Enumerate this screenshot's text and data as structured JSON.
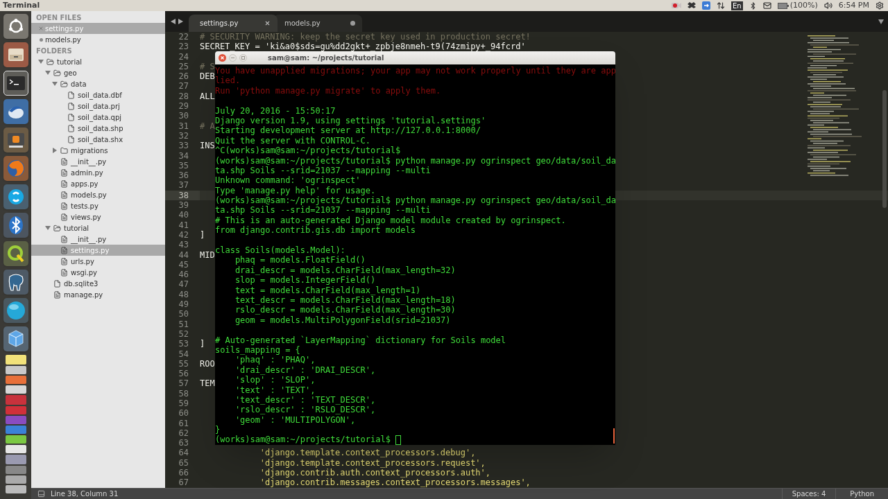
{
  "top_bar": {
    "app_title": "Terminal",
    "keyboard_layout": "En",
    "battery": "(100%)",
    "clock": "6:54 PM"
  },
  "sidebar": {
    "open_files_heading": "OPEN FILES",
    "open_files": [
      {
        "label": "settings.py",
        "selected": true,
        "modified": false
      },
      {
        "label": "models.py",
        "selected": false,
        "modified": true
      }
    ],
    "folders_heading": "FOLDERS",
    "tree": [
      {
        "label": "tutorial",
        "kind": "folder",
        "expanded": true,
        "selected": false,
        "children": [
          {
            "label": "geo",
            "kind": "folder",
            "expanded": true,
            "selected": false,
            "children": [
              {
                "label": "data",
                "kind": "folder",
                "expanded": true,
                "selected": false,
                "children": [
                  {
                    "label": "soil_data.dbf",
                    "kind": "file",
                    "selected": false
                  },
                  {
                    "label": "soil_data.prj",
                    "kind": "file",
                    "selected": false
                  },
                  {
                    "label": "soil_data.qpj",
                    "kind": "file",
                    "selected": false
                  },
                  {
                    "label": "soil_data.shp",
                    "kind": "file",
                    "selected": false
                  },
                  {
                    "label": "soil_data.shx",
                    "kind": "file",
                    "selected": false
                  }
                ]
              },
              {
                "label": "migrations",
                "kind": "folder",
                "expanded": false,
                "selected": false
              },
              {
                "label": "__init__.py",
                "kind": "file",
                "selected": false
              },
              {
                "label": "admin.py",
                "kind": "file",
                "selected": false
              },
              {
                "label": "apps.py",
                "kind": "file",
                "selected": false
              },
              {
                "label": "models.py",
                "kind": "file",
                "selected": false
              },
              {
                "label": "tests.py",
                "kind": "file",
                "selected": false
              },
              {
                "label": "views.py",
                "kind": "file",
                "selected": false
              }
            ]
          },
          {
            "label": "tutorial",
            "kind": "folder",
            "expanded": true,
            "selected": false,
            "children": [
              {
                "label": "__init__.py",
                "kind": "file",
                "selected": false
              },
              {
                "label": "settings.py",
                "kind": "file",
                "selected": true
              },
              {
                "label": "urls.py",
                "kind": "file",
                "selected": false
              },
              {
                "label": "wsgi.py",
                "kind": "file",
                "selected": false
              }
            ]
          },
          {
            "label": "db.sqlite3",
            "kind": "file",
            "selected": false
          },
          {
            "label": "manage.py",
            "kind": "file",
            "selected": false
          }
        ]
      }
    ]
  },
  "editor": {
    "tabs": [
      {
        "label": "settings.py",
        "selected": true,
        "modified": false
      },
      {
        "label": "models.py",
        "selected": false,
        "modified": true
      }
    ],
    "lines": [
      {
        "number": "22",
        "current": false,
        "kind": "comment",
        "text": "# SECURITY WARNING: keep the secret key used in production secret!"
      },
      {
        "number": "23",
        "current": false,
        "kind": "code",
        "text": "SECRET_KEY = 'ki&a0$sds=gu%dd2gkt+_zpbje8nmeh-t9(74zmipy+_94fcrd'"
      },
      {
        "number": "24",
        "current": false
      },
      {
        "number": "25",
        "current": false,
        "kind": "comment",
        "text": "# S"
      },
      {
        "number": "26",
        "current": false,
        "kind": "code",
        "text": "DEB"
      },
      {
        "number": "27",
        "current": false
      },
      {
        "number": "28",
        "current": false,
        "kind": "code",
        "text": "ALL"
      },
      {
        "number": "29",
        "current": false
      },
      {
        "number": "30",
        "current": false
      },
      {
        "number": "31",
        "current": false,
        "kind": "comment",
        "text": "# A"
      },
      {
        "number": "32",
        "current": false
      },
      {
        "number": "33",
        "current": false,
        "kind": "code",
        "text": "INS"
      },
      {
        "number": "34",
        "current": false
      },
      {
        "number": "35",
        "current": false
      },
      {
        "number": "36",
        "current": false
      },
      {
        "number": "37",
        "current": false
      },
      {
        "number": "38",
        "current": true
      },
      {
        "number": "39",
        "current": false
      },
      {
        "number": "40",
        "current": false
      },
      {
        "number": "41",
        "current": false
      },
      {
        "number": "42",
        "current": false,
        "kind": "code",
        "text": "]"
      },
      {
        "number": "43",
        "current": false
      },
      {
        "number": "44",
        "current": false,
        "kind": "code",
        "text": "MID"
      },
      {
        "number": "45",
        "current": false
      },
      {
        "number": "46",
        "current": false
      },
      {
        "number": "47",
        "current": false
      },
      {
        "number": "48",
        "current": false
      },
      {
        "number": "49",
        "current": false
      },
      {
        "number": "50",
        "current": false
      },
      {
        "number": "51",
        "current": false
      },
      {
        "number": "52",
        "current": false
      },
      {
        "number": "53",
        "current": false,
        "kind": "code",
        "text": "]"
      },
      {
        "number": "54",
        "current": false
      },
      {
        "number": "55",
        "current": false,
        "kind": "code",
        "text": "ROO"
      },
      {
        "number": "56",
        "current": false
      },
      {
        "number": "57",
        "current": false,
        "kind": "code",
        "text": "TEM"
      },
      {
        "number": "58",
        "current": false
      },
      {
        "number": "59",
        "current": false
      },
      {
        "number": "60",
        "current": false
      },
      {
        "number": "61",
        "current": false
      },
      {
        "number": "62",
        "current": false
      },
      {
        "number": "63",
        "current": false
      },
      {
        "number": "64",
        "current": false,
        "kind": "string",
        "text": "            'django.template.context_processors.debug',"
      },
      {
        "number": "65",
        "current": false,
        "kind": "string",
        "text": "            'django.template.context_processors.request',"
      },
      {
        "number": "66",
        "current": false,
        "kind": "string",
        "text": "            'django.contrib.auth.context_processors.auth',"
      },
      {
        "number": "67",
        "current": false,
        "kind": "string",
        "text": "            'django.contrib.messages.context_processors.messages',"
      }
    ]
  },
  "terminal": {
    "title": "sam@sam: ~/projects/tutorial",
    "lines": [
      {
        "kind": "error",
        "text": "You have unapplied migrations; your app may not work properly until they are app"
      },
      {
        "kind": "error",
        "text": "lied."
      },
      {
        "kind": "error",
        "text": "Run 'python manage.py migrate' to apply them."
      },
      {
        "kind": "blank"
      },
      {
        "kind": "output",
        "text": "July 20, 2016 - 15:50:17"
      },
      {
        "kind": "output",
        "text": "Django version 1.9, using settings 'tutorial.settings'"
      },
      {
        "kind": "output",
        "text": "Starting development server at http://127.0.0.1:8000/"
      },
      {
        "kind": "output",
        "text": "Quit the server with CONTROL-C."
      },
      {
        "kind": "output",
        "text": "^C(works)sam@sam:~/projects/tutorial$"
      },
      {
        "kind": "output",
        "text": "(works)sam@sam:~/projects/tutorial$ python manage.py ogrinspect geo/data/soil_da"
      },
      {
        "kind": "output",
        "text": "ta.shp Soils --srid=21037 --mapping --multi"
      },
      {
        "kind": "output",
        "text": "Unknown command: 'ogrinspect'"
      },
      {
        "kind": "output",
        "text": "Type 'manage.py help' for usage."
      },
      {
        "kind": "output",
        "text": "(works)sam@sam:~/projects/tutorial$ python manage.py ogrinspect geo/data/soil_da"
      },
      {
        "kind": "output",
        "text": "ta.shp Soils --srid=21037 --mapping --multi"
      },
      {
        "kind": "output",
        "text": "# This is an auto-generated Django model module created by ogrinspect."
      },
      {
        "kind": "output",
        "text": "from django.contrib.gis.db import models"
      },
      {
        "kind": "blank"
      },
      {
        "kind": "output",
        "text": "class Soils(models.Model):"
      },
      {
        "kind": "output",
        "text": "    phaq = models.FloatField()"
      },
      {
        "kind": "output",
        "text": "    drai_descr = models.CharField(max_length=32)"
      },
      {
        "kind": "output",
        "text": "    slop = models.IntegerField()"
      },
      {
        "kind": "output",
        "text": "    text = models.CharField(max_length=1)"
      },
      {
        "kind": "output",
        "text": "    text_descr = models.CharField(max_length=18)"
      },
      {
        "kind": "output",
        "text": "    rslo_descr = models.CharField(max_length=30)"
      },
      {
        "kind": "output",
        "text": "    geom = models.MultiPolygonField(srid=21037)"
      },
      {
        "kind": "blank"
      },
      {
        "kind": "output",
        "text": "# Auto-generated `LayerMapping` dictionary for Soils model"
      },
      {
        "kind": "output",
        "text": "soils_mapping = {"
      },
      {
        "kind": "output",
        "text": "    'phaq' : 'PHAQ',"
      },
      {
        "kind": "output",
        "text": "    'drai_descr' : 'DRAI_DESCR',"
      },
      {
        "kind": "output",
        "text": "    'slop' : 'SLOP',"
      },
      {
        "kind": "output",
        "text": "    'text' : 'TEXT',"
      },
      {
        "kind": "output",
        "text": "    'text_descr' : 'TEXT_DESCR',"
      },
      {
        "kind": "output",
        "text": "    'rslo_descr' : 'RSLO_DESCR',"
      },
      {
        "kind": "output",
        "text": "    'geom' : 'MULTIPOLYGON',"
      },
      {
        "kind": "output",
        "text": "}"
      },
      {
        "kind": "prompt",
        "text": "(works)sam@sam:~/projects/tutorial$"
      }
    ]
  },
  "status_bar": {
    "position": "Line 38, Column 31",
    "indentation": "Spaces: 4",
    "syntax": "Python"
  }
}
